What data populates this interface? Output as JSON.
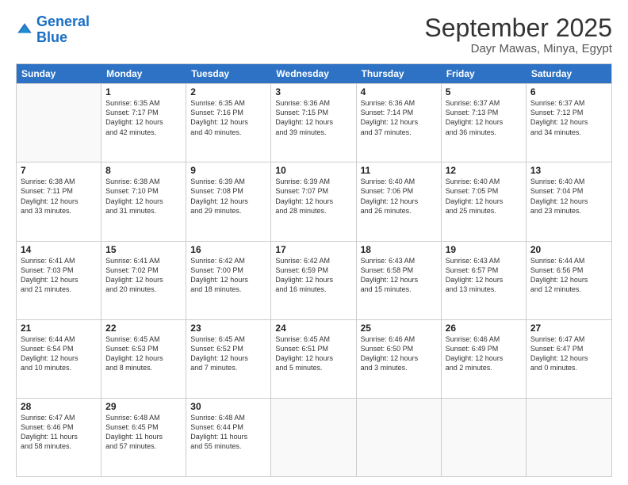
{
  "logo": {
    "line1": "General",
    "line2": "Blue"
  },
  "title": "September 2025",
  "location": "Dayr Mawas, Minya, Egypt",
  "header_days": [
    "Sunday",
    "Monday",
    "Tuesday",
    "Wednesday",
    "Thursday",
    "Friday",
    "Saturday"
  ],
  "weeks": [
    [
      {
        "day": "",
        "lines": []
      },
      {
        "day": "1",
        "lines": [
          "Sunrise: 6:35 AM",
          "Sunset: 7:17 PM",
          "Daylight: 12 hours",
          "and 42 minutes."
        ]
      },
      {
        "day": "2",
        "lines": [
          "Sunrise: 6:35 AM",
          "Sunset: 7:16 PM",
          "Daylight: 12 hours",
          "and 40 minutes."
        ]
      },
      {
        "day": "3",
        "lines": [
          "Sunrise: 6:36 AM",
          "Sunset: 7:15 PM",
          "Daylight: 12 hours",
          "and 39 minutes."
        ]
      },
      {
        "day": "4",
        "lines": [
          "Sunrise: 6:36 AM",
          "Sunset: 7:14 PM",
          "Daylight: 12 hours",
          "and 37 minutes."
        ]
      },
      {
        "day": "5",
        "lines": [
          "Sunrise: 6:37 AM",
          "Sunset: 7:13 PM",
          "Daylight: 12 hours",
          "and 36 minutes."
        ]
      },
      {
        "day": "6",
        "lines": [
          "Sunrise: 6:37 AM",
          "Sunset: 7:12 PM",
          "Daylight: 12 hours",
          "and 34 minutes."
        ]
      }
    ],
    [
      {
        "day": "7",
        "lines": [
          "Sunrise: 6:38 AM",
          "Sunset: 7:11 PM",
          "Daylight: 12 hours",
          "and 33 minutes."
        ]
      },
      {
        "day": "8",
        "lines": [
          "Sunrise: 6:38 AM",
          "Sunset: 7:10 PM",
          "Daylight: 12 hours",
          "and 31 minutes."
        ]
      },
      {
        "day": "9",
        "lines": [
          "Sunrise: 6:39 AM",
          "Sunset: 7:08 PM",
          "Daylight: 12 hours",
          "and 29 minutes."
        ]
      },
      {
        "day": "10",
        "lines": [
          "Sunrise: 6:39 AM",
          "Sunset: 7:07 PM",
          "Daylight: 12 hours",
          "and 28 minutes."
        ]
      },
      {
        "day": "11",
        "lines": [
          "Sunrise: 6:40 AM",
          "Sunset: 7:06 PM",
          "Daylight: 12 hours",
          "and 26 minutes."
        ]
      },
      {
        "day": "12",
        "lines": [
          "Sunrise: 6:40 AM",
          "Sunset: 7:05 PM",
          "Daylight: 12 hours",
          "and 25 minutes."
        ]
      },
      {
        "day": "13",
        "lines": [
          "Sunrise: 6:40 AM",
          "Sunset: 7:04 PM",
          "Daylight: 12 hours",
          "and 23 minutes."
        ]
      }
    ],
    [
      {
        "day": "14",
        "lines": [
          "Sunrise: 6:41 AM",
          "Sunset: 7:03 PM",
          "Daylight: 12 hours",
          "and 21 minutes."
        ]
      },
      {
        "day": "15",
        "lines": [
          "Sunrise: 6:41 AM",
          "Sunset: 7:02 PM",
          "Daylight: 12 hours",
          "and 20 minutes."
        ]
      },
      {
        "day": "16",
        "lines": [
          "Sunrise: 6:42 AM",
          "Sunset: 7:00 PM",
          "Daylight: 12 hours",
          "and 18 minutes."
        ]
      },
      {
        "day": "17",
        "lines": [
          "Sunrise: 6:42 AM",
          "Sunset: 6:59 PM",
          "Daylight: 12 hours",
          "and 16 minutes."
        ]
      },
      {
        "day": "18",
        "lines": [
          "Sunrise: 6:43 AM",
          "Sunset: 6:58 PM",
          "Daylight: 12 hours",
          "and 15 minutes."
        ]
      },
      {
        "day": "19",
        "lines": [
          "Sunrise: 6:43 AM",
          "Sunset: 6:57 PM",
          "Daylight: 12 hours",
          "and 13 minutes."
        ]
      },
      {
        "day": "20",
        "lines": [
          "Sunrise: 6:44 AM",
          "Sunset: 6:56 PM",
          "Daylight: 12 hours",
          "and 12 minutes."
        ]
      }
    ],
    [
      {
        "day": "21",
        "lines": [
          "Sunrise: 6:44 AM",
          "Sunset: 6:54 PM",
          "Daylight: 12 hours",
          "and 10 minutes."
        ]
      },
      {
        "day": "22",
        "lines": [
          "Sunrise: 6:45 AM",
          "Sunset: 6:53 PM",
          "Daylight: 12 hours",
          "and 8 minutes."
        ]
      },
      {
        "day": "23",
        "lines": [
          "Sunrise: 6:45 AM",
          "Sunset: 6:52 PM",
          "Daylight: 12 hours",
          "and 7 minutes."
        ]
      },
      {
        "day": "24",
        "lines": [
          "Sunrise: 6:45 AM",
          "Sunset: 6:51 PM",
          "Daylight: 12 hours",
          "and 5 minutes."
        ]
      },
      {
        "day": "25",
        "lines": [
          "Sunrise: 6:46 AM",
          "Sunset: 6:50 PM",
          "Daylight: 12 hours",
          "and 3 minutes."
        ]
      },
      {
        "day": "26",
        "lines": [
          "Sunrise: 6:46 AM",
          "Sunset: 6:49 PM",
          "Daylight: 12 hours",
          "and 2 minutes."
        ]
      },
      {
        "day": "27",
        "lines": [
          "Sunrise: 6:47 AM",
          "Sunset: 6:47 PM",
          "Daylight: 12 hours",
          "and 0 minutes."
        ]
      }
    ],
    [
      {
        "day": "28",
        "lines": [
          "Sunrise: 6:47 AM",
          "Sunset: 6:46 PM",
          "Daylight: 11 hours",
          "and 58 minutes."
        ]
      },
      {
        "day": "29",
        "lines": [
          "Sunrise: 6:48 AM",
          "Sunset: 6:45 PM",
          "Daylight: 11 hours",
          "and 57 minutes."
        ]
      },
      {
        "day": "30",
        "lines": [
          "Sunrise: 6:48 AM",
          "Sunset: 6:44 PM",
          "Daylight: 11 hours",
          "and 55 minutes."
        ]
      },
      {
        "day": "",
        "lines": []
      },
      {
        "day": "",
        "lines": []
      },
      {
        "day": "",
        "lines": []
      },
      {
        "day": "",
        "lines": []
      }
    ]
  ]
}
